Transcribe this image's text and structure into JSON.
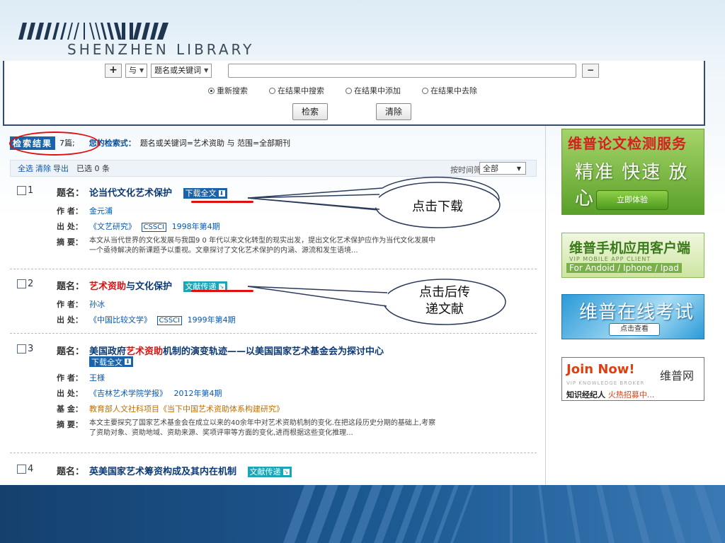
{
  "header": {
    "logo_text": "SHENZHEN LIBRARY"
  },
  "search": {
    "add_symbol": "+",
    "logic_select": "与",
    "field_select": "题名或关键词",
    "query_value": "",
    "remove_symbol": "−",
    "radios": [
      {
        "label": "重新搜索",
        "checked": true
      },
      {
        "label": "在结果中搜索",
        "checked": false
      },
      {
        "label": "在结果中添加",
        "checked": false
      },
      {
        "label": "在结果中去除",
        "checked": false
      }
    ],
    "search_button": "检索",
    "clear_button": "清除"
  },
  "results": {
    "title": "检索结果",
    "count": "7篇;",
    "cond_label": "您的检索式：",
    "cond_value": "题名或关键词=艺术资助 与 范围=全部期刊",
    "toolbar": {
      "select_all": "全选",
      "clear": "清除",
      "export": "导出",
      "selected": "已选  0  条",
      "filter_label": "按时间筛选",
      "filter_value": "全部"
    },
    "items": [
      {
        "num": "1",
        "title_label": "题名：",
        "title": "论当代文化艺术保护",
        "tag": "下载全文",
        "author_label": "作 者：",
        "author": "金元浦",
        "source_label": "出 处：",
        "source": "《文艺研究》",
        "cssci": "CSSCI",
        "issue": "1998年第4期",
        "abstract_label": "摘 要：",
        "abstract_1": "本文从当代世界的文化发展与我国9 0 年代以来文化转型的现实出发，提出文化艺术保护应作为当代文化发展中",
        "abstract_2": "一个亟待解决的新课题予以重视。文章探讨了文化艺术保护的内涵、源流和发生语境..."
      },
      {
        "num": "2",
        "title_label": "题名：",
        "title_hl": "艺术资助",
        "title_rest": "与文化保护",
        "tag": "文献传递",
        "author_label": "作 者：",
        "author": "孙冰",
        "source_label": "出 处：",
        "source": "《中国比较文学》",
        "cssci": "CSSCI",
        "issue": "1999年第4期"
      },
      {
        "num": "3",
        "title_label": "题名：",
        "title_pre": "美国政府",
        "title_hl": "艺术资助",
        "title_rest": "机制的演变轨迹——以美国国家艺术基金会为探讨中心",
        "tag": "下载全文",
        "author_label": "作 者：",
        "author": "王様",
        "source_label": "出 处：",
        "source": "《吉林艺术学院学报》",
        "issue": "2012年第4期",
        "fund_label": "基 金：",
        "fund": "教育部人文社科项目《当下中国艺术资助体系构建研究》",
        "abstract_label": "摘 要：",
        "abstract_1": "本文主要探究了国家艺术基金会在成立以来的40余年中对艺术资助机制的变化.在把这段历史分期的基础上,考察",
        "abstract_2": "了资助对象、资助地域、资助来源、奖项评审等方面的变化,进而根据这些变化推理..."
      },
      {
        "num": "4",
        "title_label": "题名：",
        "title": "英美国家艺术筹资构成及其内在机制",
        "tag": "文献传递"
      }
    ]
  },
  "callouts": {
    "download": "点击下载",
    "deliver_1": "点击后传",
    "deliver_2": "递文献"
  },
  "ads": {
    "ad1_line1": "维普论文检测服务",
    "ad1_line2": "精准 快速 放心",
    "ad1_button": "立即体验",
    "ad2_line1": "维普手机应用客户端",
    "ad2_line2": "VIP MOBILE APP CLIENT",
    "ad2_line3": "For Andoid / Iphone / Ipad",
    "ad3_line1": "维普在线考试",
    "ad3_button": "点击查看",
    "ad4_line1": "Join Now!",
    "ad4_line2": "维普网",
    "ad4_line3": "VIP KNOWLEDGE BROKER",
    "ad4_line4a": "知识经纪人",
    "ad4_line4b": "火热招募中..."
  },
  "colors": {
    "accent": "#1b63a8",
    "highlight": "#e01010",
    "link": "#0a58b0"
  }
}
